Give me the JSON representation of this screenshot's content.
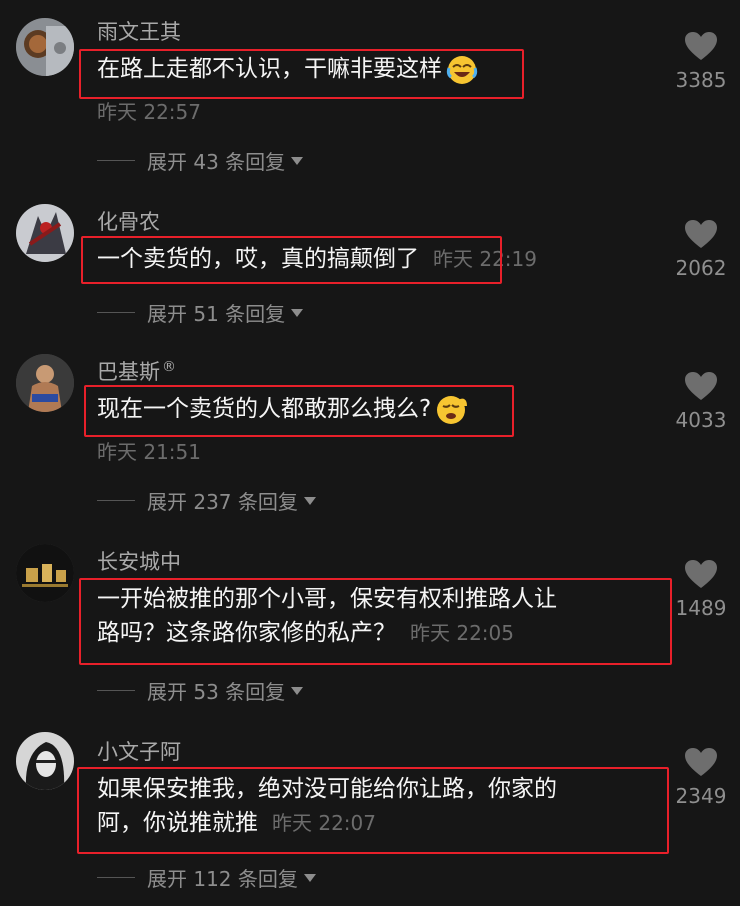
{
  "comments": [
    {
      "username": "雨文王其",
      "text": "在路上走都不认识，干嘛非要这样",
      "time": "昨天 22:57",
      "reply_label": "展开 43 条回复",
      "likes": "3385",
      "emoji": "laughing-tears"
    },
    {
      "username": "化骨农",
      "text": "一个卖货的，哎，真的搞颠倒了",
      "time": "昨天 22:19",
      "reply_label": "展开 51 条回复",
      "likes": "2062"
    },
    {
      "username": "巴基斯",
      "reg_mark": "®",
      "text": "现在一个卖货的人都敢那么拽么?",
      "time": "昨天 21:51",
      "reply_label": "展开 237 条回复",
      "likes": "4033",
      "emoji": "crying-face"
    },
    {
      "username": "长安城中",
      "text_line1": "一开始被推的那个小哥，保安有权利推路人让",
      "text_line2": "路吗？这条路你家修的私产？",
      "time": "昨天 22:05",
      "reply_label": "展开 53 条回复",
      "likes": "1489"
    },
    {
      "username": "小文子阿",
      "text_line1": "如果保安推我，绝对没可能给你让路，你家的",
      "text_line2": "阿，你说推就推",
      "time": "昨天 22:07",
      "reply_label": "展开 112 条回复",
      "likes": "2349"
    }
  ],
  "colors": {
    "background": "#161616",
    "highlight_box": "#e8202a",
    "username": "#a9a9a9",
    "timestamp": "#6c6c6c"
  },
  "icons": [
    "heart-icon",
    "chevron-down-icon"
  ]
}
